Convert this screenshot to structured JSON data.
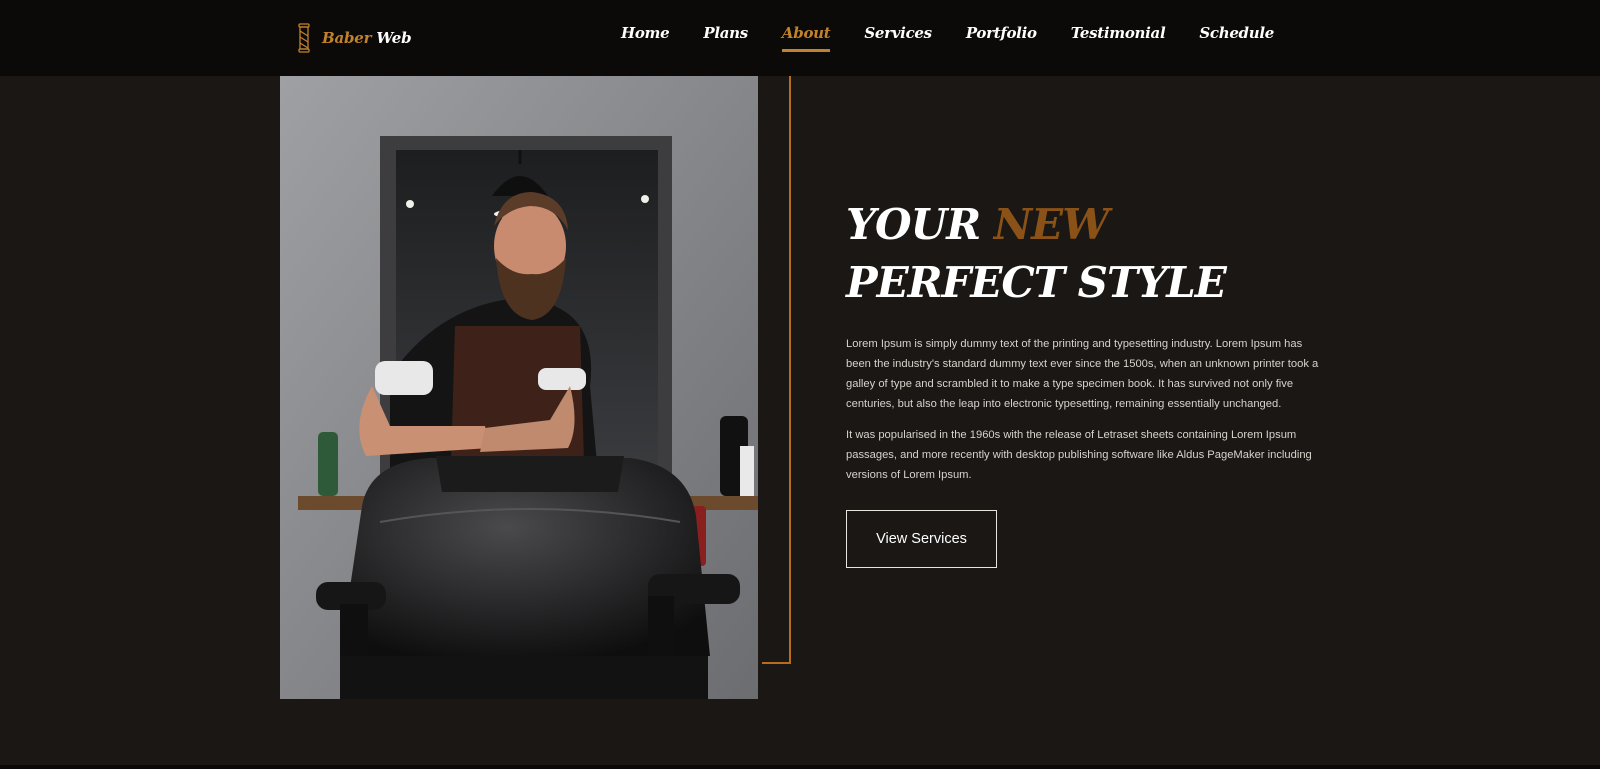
{
  "brand": {
    "accent": "Baber",
    "main": "Web",
    "icon": "barber-pole-icon"
  },
  "nav": {
    "items": [
      {
        "label": "Home",
        "active": false
      },
      {
        "label": "Plans",
        "active": false
      },
      {
        "label": "About",
        "active": true
      },
      {
        "label": "Services",
        "active": false
      },
      {
        "label": "Portfolio",
        "active": false
      },
      {
        "label": "Testimonial",
        "active": false
      },
      {
        "label": "Schedule",
        "active": false
      }
    ]
  },
  "hero": {
    "headline_line1_a": "YOUR",
    "headline_line1_b": "NEW",
    "headline_line2": "PERFECT STYLE",
    "paragraph1": "Lorem Ipsum is simply dummy text of the printing and typesetting industry. Lorem Ipsum has been the industry's standard dummy text ever since the 1500s, when an unknown printer took a galley of type and scrambled it to make a type specimen book. It has survived not only five centuries, but also the leap into electronic typesetting, remaining essentially unchanged.",
    "paragraph2": "It was popularised in the 1960s with the release of Letraset sheets containing Lorem Ipsum passages, and more recently with desktop publishing software like Aldus PageMaker including versions of Lorem Ipsum.",
    "button_label": "View Services"
  },
  "colors": {
    "accent": "#c1822c",
    "accent_dark": "#8a5217",
    "frame": "#b66d1e",
    "background": "#1a1714",
    "navbar": "#0b0a09"
  }
}
